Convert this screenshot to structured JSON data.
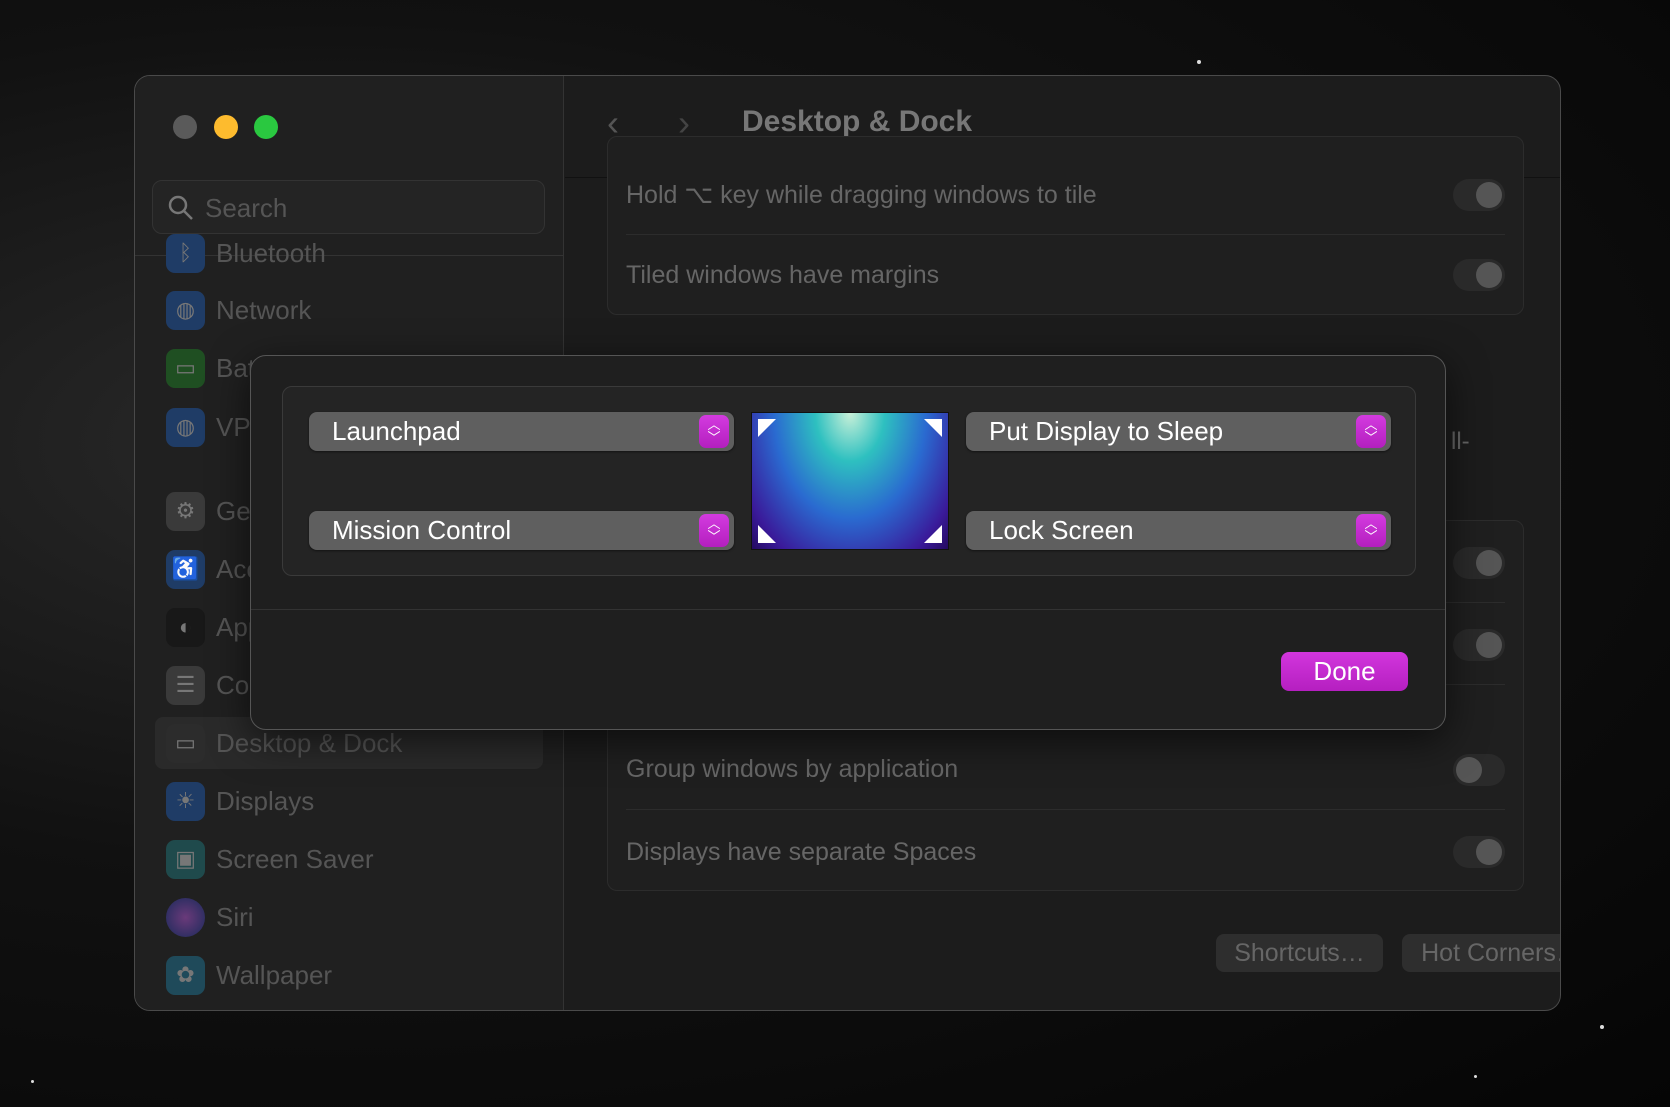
{
  "sidebar": {
    "search_placeholder": "Search",
    "items": [
      {
        "label": "Bluetooth",
        "icon": "bluetooth-icon"
      },
      {
        "label": "Network",
        "icon": "globe-icon"
      },
      {
        "label": "Battery",
        "icon": "battery-icon"
      },
      {
        "label": "VPN",
        "icon": "vpn-globe-icon"
      },
      {
        "label": "General",
        "icon": "gear-icon"
      },
      {
        "label": "Accessibility",
        "icon": "accessibility-icon"
      },
      {
        "label": "Appearance",
        "icon": "appearance-icon"
      },
      {
        "label": "Control Center",
        "icon": "toggles-icon"
      },
      {
        "label": "Desktop & Dock",
        "icon": "dock-icon"
      },
      {
        "label": "Displays",
        "icon": "sun-icon"
      },
      {
        "label": "Screen Saver",
        "icon": "screen-saver-icon"
      },
      {
        "label": "Siri",
        "icon": "siri-icon"
      },
      {
        "label": "Wallpaper",
        "icon": "flower-icon"
      }
    ],
    "selected": "Desktop & Dock"
  },
  "header": {
    "title": "Desktop & Dock",
    "back": "‹",
    "forward": "›"
  },
  "settings": {
    "rows_top": [
      {
        "label": "Hold ⌥ key while dragging windows to tile",
        "on": true
      },
      {
        "label": "Tiled windows have margins",
        "on": true
      }
    ],
    "partial_text": "ll-",
    "rows_bottom": [
      {
        "label": "Group windows by application",
        "on": false
      },
      {
        "label": "Displays have separate Spaces",
        "on": true
      }
    ],
    "shortcuts_label": "Shortcuts…",
    "hot_corners_label": "Hot Corners…",
    "help_label": "?"
  },
  "dialog": {
    "top_left": "Launchpad",
    "bottom_left": "Mission Control",
    "top_right": "Put Display to Sleep",
    "bottom_right": "Lock Screen",
    "done_label": "Done"
  },
  "colors": {
    "accent": "#c62ad0",
    "close": "#5a5a5a",
    "minimize": "#fdbb2e",
    "zoom": "#2ac840"
  }
}
